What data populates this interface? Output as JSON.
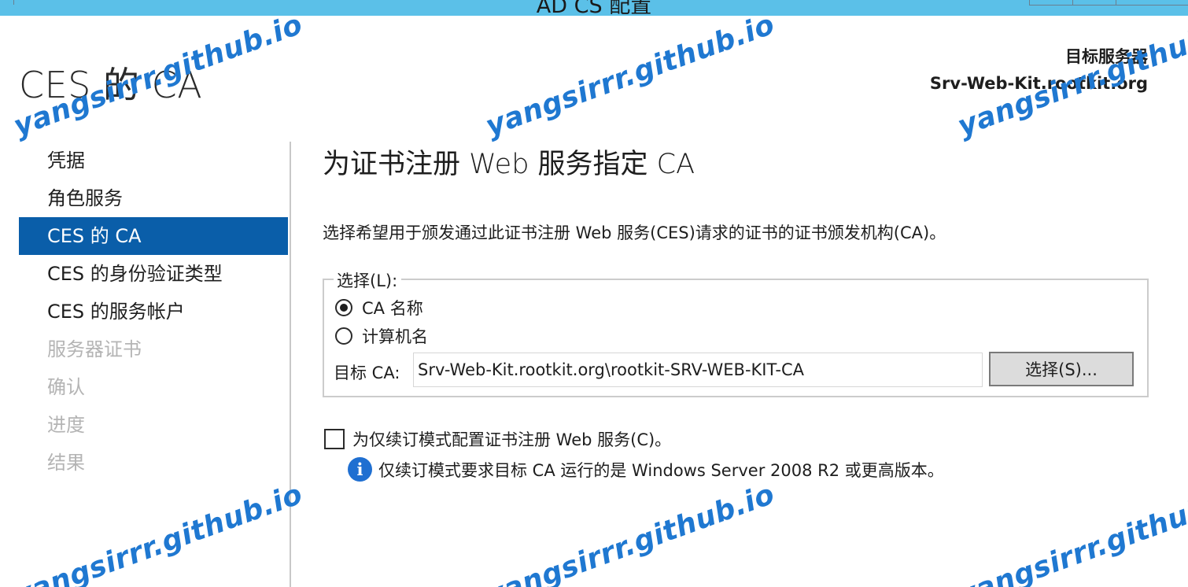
{
  "window": {
    "title": "AD CS 配置"
  },
  "page_title": "CES 的 CA",
  "target_server": {
    "label": "目标服务器",
    "name": "Srv-Web-Kit.rootkit.org"
  },
  "nav": {
    "items": [
      {
        "label": "凭据",
        "state": "normal"
      },
      {
        "label": "角色服务",
        "state": "normal"
      },
      {
        "label": "CES 的 CA",
        "state": "active"
      },
      {
        "label": "CES 的身份验证类型",
        "state": "normal"
      },
      {
        "label": "CES 的服务帐户",
        "state": "normal"
      },
      {
        "label": "服务器证书",
        "state": "disabled"
      },
      {
        "label": "确认",
        "state": "disabled"
      },
      {
        "label": "进度",
        "state": "disabled"
      },
      {
        "label": "结果",
        "state": "disabled"
      }
    ]
  },
  "main": {
    "heading": "为证书注册 Web 服务指定 CA",
    "description": "选择希望用于颁发通过此证书注册 Web 服务(CES)请求的证书的证书颁发机构(CA)。",
    "select_group": {
      "legend": "选择(L):",
      "options": [
        {
          "label": "CA 名称",
          "checked": true
        },
        {
          "label": "计算机名",
          "checked": false
        }
      ],
      "target_label": "目标 CA:",
      "target_value": "Srv-Web-Kit.rootkit.org\\rootkit-SRV-WEB-KIT-CA",
      "select_button": "选择(S)..."
    },
    "renewal_checkbox": {
      "label": "为仅续订模式配置证书注册 Web 服务(C)。",
      "checked": false
    },
    "info_text": "仅续订模式要求目标 CA 运行的是 Windows Server 2008 R2 或更高版本。"
  },
  "watermark": "yangsirrr.github.io",
  "colors": {
    "title_bar": "#5bc0e8",
    "nav_active": "#0a5ea9",
    "info_icon": "#1f6fd1",
    "watermark": "#1f78d1",
    "disabled_text": "#b4b4b4"
  }
}
